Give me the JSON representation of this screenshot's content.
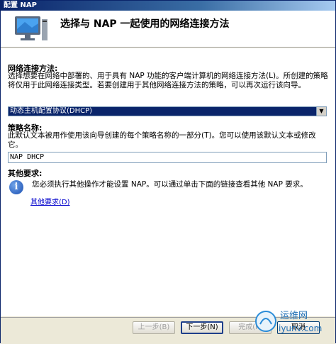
{
  "window": {
    "title": "配置 NAP"
  },
  "header": {
    "title": "选择与 NAP 一起使用的网络连接方法"
  },
  "connection_method": {
    "label": "网络连接方法:",
    "description": "选择想要在网络中部署的、用于具有 NAP 功能的客户端计算机的网络连接方法(L)。所创建的策略将仅用于此网络连接类型。若要创建用于其他网络连接方法的策略，可以再次运行该向导。",
    "selected_value": "动态主机配置协议(DHCP)"
  },
  "policy_name": {
    "label": "策略名称:",
    "description": "此默认文本被用作使用该向导创建的每个策略名称的一部分(T)。您可以使用该默认文本或修改它。",
    "value": "NAP DHCP"
  },
  "other_requirements": {
    "label": "其他要求:",
    "info_text": "您必须执行其他操作才能设置 NAP。可以通过单击下面的链接查看其他 NAP 要求。",
    "link_text": "其他要求(D)"
  },
  "footer": {
    "back_label": "上一步(B)",
    "next_label": "下一步(N)",
    "finish_label": "完成(F)",
    "cancel_label": "取消"
  },
  "watermark": {
    "brand": "运维网",
    "site": "iyunv.com"
  },
  "icons": {
    "header": "monitor-icon",
    "info": "info-icon",
    "dropdown": "chevron-down-icon"
  }
}
